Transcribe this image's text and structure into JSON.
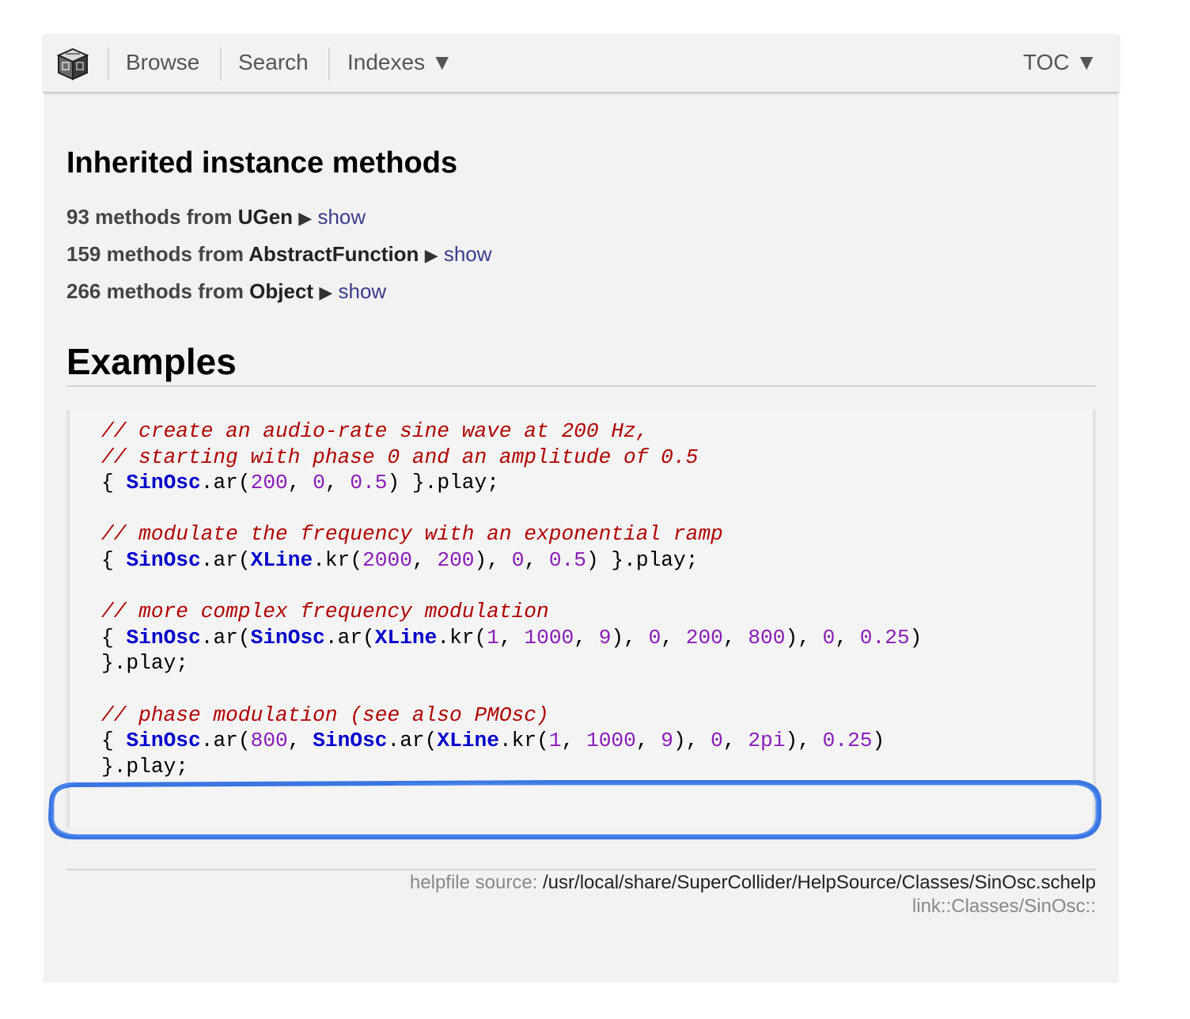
{
  "nav": {
    "logo_icon": "supercollider-cube-icon",
    "browse": "Browse",
    "search": "Search",
    "indexes": "Indexes ▼",
    "toc": "TOC ▼"
  },
  "inherited": {
    "heading": "Inherited instance methods",
    "rows": [
      {
        "prefix": "93 methods from ",
        "cls": "UGen",
        "arrow": "▶",
        "show": "show"
      },
      {
        "prefix": "159 methods from ",
        "cls": "AbstractFunction",
        "arrow": "▶",
        "show": "show"
      },
      {
        "prefix": "266 methods from ",
        "cls": "Object",
        "arrow": "▶",
        "show": "show"
      }
    ]
  },
  "examples": {
    "heading": "Examples",
    "code": [
      [
        {
          "t": "cm",
          "v": "// create an audio-rate sine wave at 200 Hz,"
        }
      ],
      [
        {
          "t": "cm",
          "v": "// starting with phase 0 and an amplitude of 0.5"
        }
      ],
      [
        {
          "t": "p",
          "v": "{ "
        },
        {
          "t": "cls",
          "v": "SinOsc"
        },
        {
          "t": "p",
          "v": ".ar("
        },
        {
          "t": "num",
          "v": "200"
        },
        {
          "t": "p",
          "v": ", "
        },
        {
          "t": "num",
          "v": "0"
        },
        {
          "t": "p",
          "v": ", "
        },
        {
          "t": "num",
          "v": "0.5"
        },
        {
          "t": "p",
          "v": ") }.play;"
        }
      ],
      [],
      [
        {
          "t": "cm",
          "v": "// modulate the frequency with an exponential ramp"
        }
      ],
      [
        {
          "t": "p",
          "v": "{ "
        },
        {
          "t": "cls",
          "v": "SinOsc"
        },
        {
          "t": "p",
          "v": ".ar("
        },
        {
          "t": "cls",
          "v": "XLine"
        },
        {
          "t": "p",
          "v": ".kr("
        },
        {
          "t": "num",
          "v": "2000"
        },
        {
          "t": "p",
          "v": ", "
        },
        {
          "t": "num",
          "v": "200"
        },
        {
          "t": "p",
          "v": "), "
        },
        {
          "t": "num",
          "v": "0"
        },
        {
          "t": "p",
          "v": ", "
        },
        {
          "t": "num",
          "v": "0.5"
        },
        {
          "t": "p",
          "v": ") }.play;"
        }
      ],
      [],
      [
        {
          "t": "cm",
          "v": "// more complex frequency modulation"
        }
      ],
      [
        {
          "t": "p",
          "v": "{ "
        },
        {
          "t": "cls",
          "v": "SinOsc"
        },
        {
          "t": "p",
          "v": ".ar("
        },
        {
          "t": "cls",
          "v": "SinOsc"
        },
        {
          "t": "p",
          "v": ".ar("
        },
        {
          "t": "cls",
          "v": "XLine"
        },
        {
          "t": "p",
          "v": ".kr("
        },
        {
          "t": "num",
          "v": "1"
        },
        {
          "t": "p",
          "v": ", "
        },
        {
          "t": "num",
          "v": "1000"
        },
        {
          "t": "p",
          "v": ", "
        },
        {
          "t": "num",
          "v": "9"
        },
        {
          "t": "p",
          "v": "), "
        },
        {
          "t": "num",
          "v": "0"
        },
        {
          "t": "p",
          "v": ", "
        },
        {
          "t": "num",
          "v": "200"
        },
        {
          "t": "p",
          "v": ", "
        },
        {
          "t": "num",
          "v": "800"
        },
        {
          "t": "p",
          "v": "), "
        },
        {
          "t": "num",
          "v": "0"
        },
        {
          "t": "p",
          "v": ", "
        },
        {
          "t": "num",
          "v": "0.25"
        },
        {
          "t": "p",
          "v": ")"
        }
      ],
      [
        {
          "t": "p",
          "v": "}.play;"
        }
      ],
      [],
      [
        {
          "t": "cm",
          "v": "// phase modulation (see also PMOsc)"
        }
      ],
      [
        {
          "t": "p",
          "v": "{ "
        },
        {
          "t": "cls",
          "v": "SinOsc"
        },
        {
          "t": "p",
          "v": ".ar("
        },
        {
          "t": "num",
          "v": "800"
        },
        {
          "t": "p",
          "v": ", "
        },
        {
          "t": "cls",
          "v": "SinOsc"
        },
        {
          "t": "p",
          "v": ".ar("
        },
        {
          "t": "cls",
          "v": "XLine"
        },
        {
          "t": "p",
          "v": ".kr("
        },
        {
          "t": "num",
          "v": "1"
        },
        {
          "t": "p",
          "v": ", "
        },
        {
          "t": "num",
          "v": "1000"
        },
        {
          "t": "p",
          "v": ", "
        },
        {
          "t": "num",
          "v": "9"
        },
        {
          "t": "p",
          "v": "), "
        },
        {
          "t": "num",
          "v": "0"
        },
        {
          "t": "p",
          "v": ", "
        },
        {
          "t": "num",
          "v": "2pi"
        },
        {
          "t": "p",
          "v": "), "
        },
        {
          "t": "num",
          "v": "0.25"
        },
        {
          "t": "p",
          "v": ")"
        }
      ],
      [
        {
          "t": "p",
          "v": "}.play;"
        }
      ]
    ]
  },
  "footer": {
    "source_label": "helpfile source: ",
    "source_path": "/usr/local/share/SuperCollider/HelpSource/Classes/SinOsc.schelp",
    "link": "link::Classes/SinOsc::"
  },
  "colors": {
    "comment": "#b00000",
    "class": "#0000cc",
    "number": "#8a1cb8",
    "link": "#3a3e8c",
    "highlight_scribble": "#2f6fe0"
  }
}
